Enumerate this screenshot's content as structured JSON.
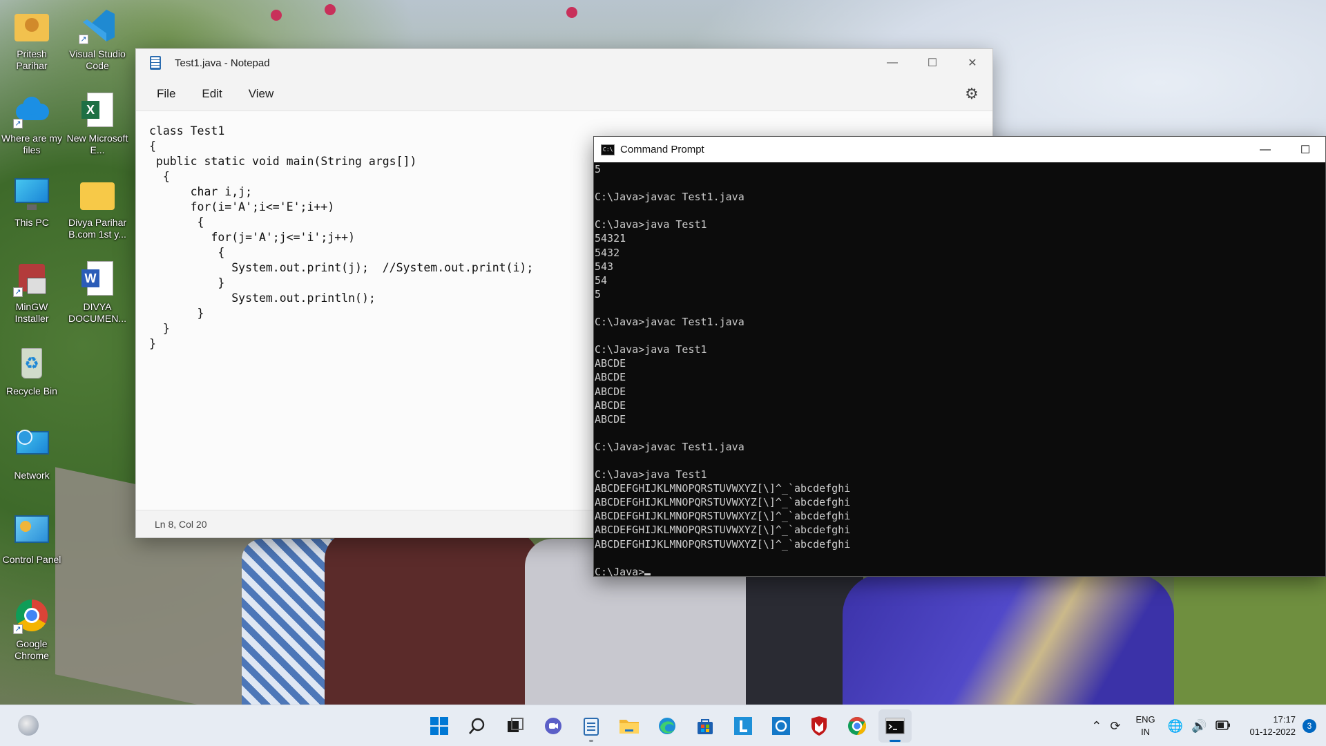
{
  "desktop": {
    "icons": [
      {
        "label": "Pritesh Parihar"
      },
      {
        "label": "Visual Studio Code"
      },
      {
        "label": "Where are my files"
      },
      {
        "label": "New Microsoft E..."
      },
      {
        "label": "This PC"
      },
      {
        "label": "Divya Parihar B.com 1st y..."
      },
      {
        "label": "MinGW Installer"
      },
      {
        "label": "DIVYA DOCUMEN..."
      },
      {
        "label": "Recycle Bin"
      },
      {
        "label": "Network"
      },
      {
        "label": "Control Panel"
      },
      {
        "label": "Google Chrome"
      }
    ]
  },
  "notepad": {
    "title": "Test1.java - Notepad",
    "menu": [
      "File",
      "Edit",
      "View"
    ],
    "code": "class Test1\n{\n public static void main(String args[])\n  {\n      char i,j;\n      for(i='A';i<='E';i++)\n       {\n         for(j='A';j<='i';j++)\n          {\n            System.out.print(j);  //System.out.print(i);\n          }\n            System.out.println();\n       }\n  }\n}",
    "status": "Ln 8, Col 20"
  },
  "cmd": {
    "title": "Command Prompt",
    "output": "5\n\nC:\\Java>javac Test1.java\n\nC:\\Java>java Test1\n54321\n5432\n543\n54\n5\n\nC:\\Java>javac Test1.java\n\nC:\\Java>java Test1\nABCDE\nABCDE\nABCDE\nABCDE\nABCDE\n\nC:\\Java>javac Test1.java\n\nC:\\Java>java Test1\nABCDEFGHIJKLMNOPQRSTUVWXYZ[\\]^_`abcdefghi\nABCDEFGHIJKLMNOPQRSTUVWXYZ[\\]^_`abcdefghi\nABCDEFGHIJKLMNOPQRSTUVWXYZ[\\]^_`abcdefghi\nABCDEFGHIJKLMNOPQRSTUVWXYZ[\\]^_`abcdefghi\nABCDEFGHIJKLMNOPQRSTUVWXYZ[\\]^_`abcdefghi\n\n",
    "prompt": "C:\\Java>"
  },
  "taskbar": {
    "apps": [
      "start-icon",
      "search-icon",
      "task-view-icon",
      "chat-icon",
      "notepad-icon",
      "file-explorer-icon",
      "edge-icon",
      "store-icon",
      "l-app-icon",
      "cortana-icon",
      "mcafee-icon",
      "chrome-icon",
      "terminal-icon"
    ],
    "language": "ENG",
    "region": "IN",
    "time": "17:17",
    "date": "01-12-2022",
    "notifications": "3"
  },
  "colors": {
    "accent": "#0067c0",
    "console_bg": "#0c0c0c",
    "console_fg": "#cccccc"
  }
}
